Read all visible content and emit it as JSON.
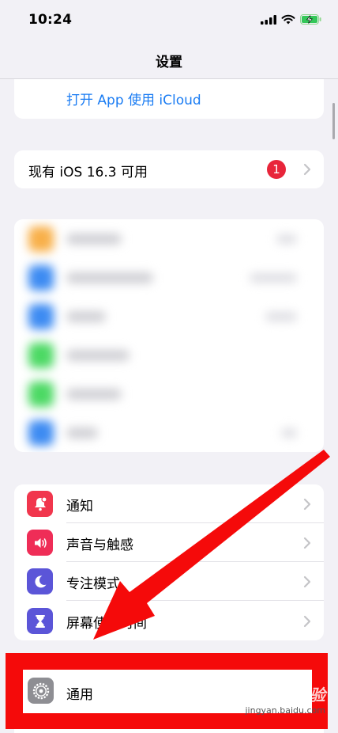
{
  "status_bar": {
    "time": "10:24"
  },
  "nav": {
    "title": "设置"
  },
  "icloud": {
    "link_label": "打开 App 使用 iCloud"
  },
  "update": {
    "label": "现有 iOS 16.3 可用",
    "badge_count": "1"
  },
  "settings_group": [
    {
      "label": "通知",
      "icon": "bell-icon",
      "color": "#f1364d"
    },
    {
      "label": "声音与触感",
      "icon": "speaker-icon",
      "color": "#ef2d57"
    },
    {
      "label": "专注模式",
      "icon": "moon-icon",
      "color": "#5b55d8"
    },
    {
      "label": "屏幕使用时间",
      "icon": "hourglass-icon",
      "color": "#5b55d8"
    }
  ],
  "general": {
    "label": "通用",
    "icon": "gear-icon",
    "color": "#8e8e93"
  },
  "watermark": {
    "logo": "Baidu经验",
    "url": "jingyan.baidu.com"
  },
  "annotation": {
    "highlight_color": "#f50a0a",
    "arrow_color": "#f50a0a"
  }
}
